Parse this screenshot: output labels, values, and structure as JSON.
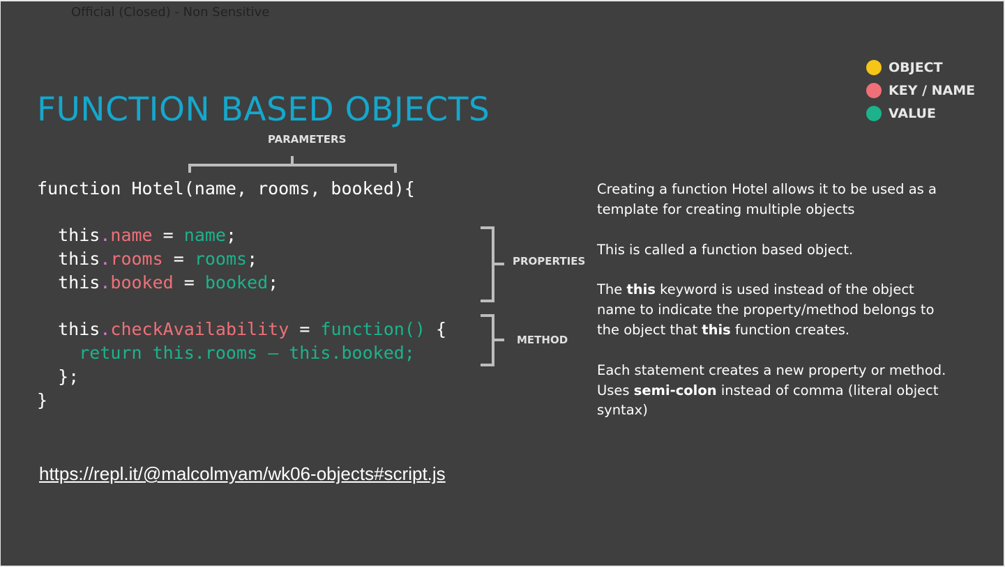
{
  "header": {
    "classification": "Official (Closed) - Non Sensitive"
  },
  "title": "FUNCTION BASED OBJECTS",
  "legend": [
    {
      "label": "OBJECT",
      "color": "#f5c518",
      "icon": "circle-icon"
    },
    {
      "label": "KEY / NAME",
      "color": "#f07078",
      "icon": "circle-icon"
    },
    {
      "label": "VALUE",
      "color": "#1cb38c",
      "icon": "circle-icon"
    }
  ],
  "annotations": {
    "parameters": "PARAMETERS",
    "properties": "PROPERTIES",
    "method": "METHOD"
  },
  "code": {
    "line1": {
      "text": "function Hotel(name, rooms, booked){"
    },
    "line2": {
      "this": "this",
      "dot": ".",
      "key": "name",
      "eq": " = ",
      "value": "name",
      "end": ";"
    },
    "line3": {
      "this": "this",
      "dot": ".",
      "key": "rooms",
      "eq": " = ",
      "value": "rooms",
      "end": ";"
    },
    "line4": {
      "this": "this",
      "dot": ".",
      "key": "booked",
      "eq": " = ",
      "value": "booked",
      "end": ";"
    },
    "line5": {
      "this": "this",
      "dot": ".",
      "key": "checkAvailability",
      "eq": " = ",
      "value": "function()",
      "end": " {"
    },
    "line6": {
      "text": "return this.rooms – this.booked;"
    },
    "line7": {
      "text": "};"
    },
    "line8": {
      "text": "}"
    }
  },
  "description": {
    "p1_line1": "Creating a function Hotel allows it to be used as a",
    "p1_line2": "template for creating multiple objects",
    "p2_line1": "This is called a function based object.",
    "p3_line1_a": "The ",
    "p3_line1_b": "this",
    "p3_line1_c": " keyword is used instead of the object",
    "p3_line2": "name to indicate the property/method belongs to",
    "p3_line3_a": "the object that ",
    "p3_line3_b": "this",
    "p3_line3_c": " function creates.",
    "p4_line1": "Each statement creates a new property or method.",
    "p4_line2_a": "Uses ",
    "p4_line2_b": "semi-colon",
    "p4_line2_c": " instead of comma (literal object",
    "p4_line3": "syntax)"
  },
  "link": {
    "text": "https://repl.it/@malcolmyam/wk06-objects#script.js"
  },
  "colors": {
    "background": "#3f3f3f",
    "title": "#16a7cc",
    "key": "#f07078",
    "value": "#1cb38c",
    "bracket": "#bdbdbd"
  }
}
